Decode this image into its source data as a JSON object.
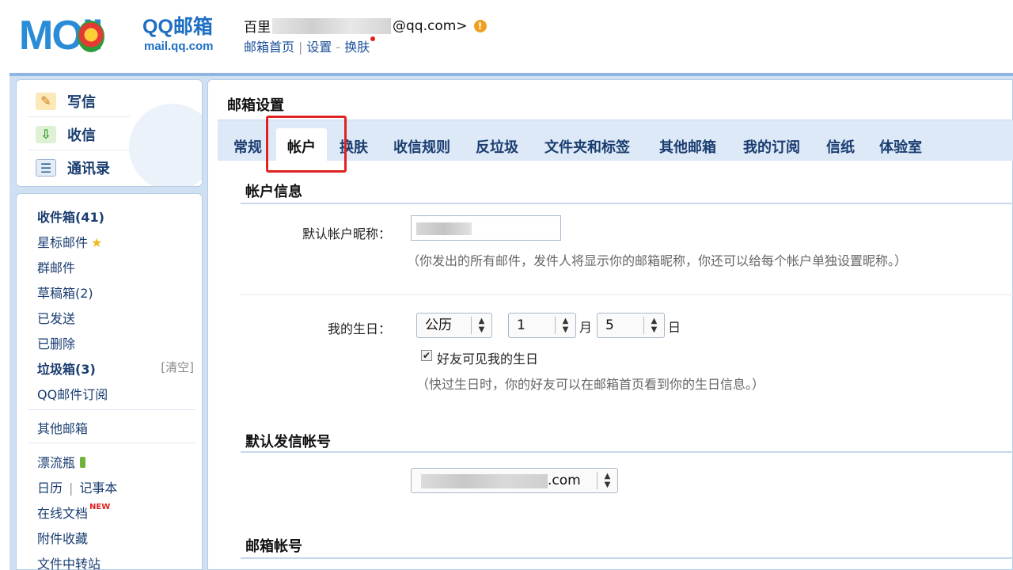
{
  "header": {
    "logo_text": "MOil",
    "logo_brand": "QQ邮箱",
    "logo_domain": "mail.qq.com",
    "user_name_prefix": "百里",
    "user_email_suffix": "@qq.com>",
    "links": [
      "邮箱首页",
      "设置",
      "换肤"
    ],
    "link_separator": "|",
    "link_dash": "-"
  },
  "sidebar": {
    "actions": {
      "write": "写信",
      "receive": "收信",
      "contacts": "通讯录"
    },
    "folders": [
      {
        "label": "收件箱(41)"
      },
      {
        "label": "星标邮件"
      },
      {
        "label": "群邮件"
      },
      {
        "label": "草稿箱(2)"
      },
      {
        "label": "已发送"
      },
      {
        "label": "已删除"
      },
      {
        "label": "垃圾箱(3)"
      },
      {
        "label": "QQ邮件订阅"
      }
    ],
    "clear_label": "[清空]",
    "other_mailbox": "其他邮箱",
    "apps": {
      "drift_bottle": "漂流瓶",
      "calendar": "日历",
      "separator": "|",
      "notebook": "记事本",
      "online_docs": "在线文档",
      "new_badge": "NEW",
      "attachments": "附件收藏",
      "file_transfer": "文件中转站"
    }
  },
  "main": {
    "title": "邮箱设置",
    "tabs": [
      {
        "label": "常规",
        "active": false
      },
      {
        "label": "帐户",
        "active": true
      },
      {
        "label": "换肤",
        "active": false
      },
      {
        "label": "收信规则",
        "active": false
      },
      {
        "label": "反垃圾",
        "active": false
      },
      {
        "label": "文件夹和标签",
        "active": false
      },
      {
        "label": "其他邮箱",
        "active": false
      },
      {
        "label": "我的订阅",
        "active": false
      },
      {
        "label": "信纸",
        "active": false
      },
      {
        "label": "体验室",
        "active": false
      }
    ],
    "account_info": {
      "title": "帐户信息",
      "nickname_label": "默认帐户昵称：",
      "nickname_hint": "（你发出的所有邮件，发件人将显示你的邮箱昵称，你还可以给每个帐户单独设置昵称。）",
      "birthday_label": "我的生日：",
      "calendar_type": "公历",
      "month_value": "1",
      "month_unit": "月",
      "day_value": "5",
      "day_unit": "日",
      "friends_visible_label": "好友可见我的生日",
      "friends_visible_checked": true,
      "birthday_hint": "（快过生日时，你的好友可以在邮箱首页看到你的生日信息。）"
    },
    "default_sender": {
      "title": "默认发信帐号",
      "account_suffix": ".com"
    },
    "mailbox_account": {
      "title": "邮箱帐号"
    }
  },
  "colors": {
    "accent_blue": "#1a3d70",
    "tab_bar": "#dde9f6",
    "highlight_red": "#e02222"
  }
}
